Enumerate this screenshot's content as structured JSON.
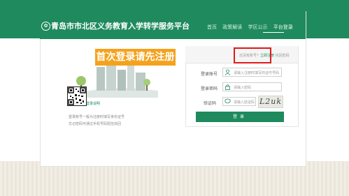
{
  "header": {
    "title": "青岛市市北区义务教育入学转学服务平台",
    "nav": [
      "首页",
      "政策解读",
      "学区公示",
      "平台登录"
    ],
    "active_nav": "平台登录",
    "logo_glyph": "✿"
  },
  "promo": {
    "banner": "首次登录请先注册"
  },
  "left": {
    "qr_label": "登录说明",
    "desc1": "登录账号一般为注册时填写身份证号",
    "desc2": "忘记密码可通过手机号码短信找回"
  },
  "login": {
    "tab_prefix": "还没有账号？",
    "tab_register": "立即注册",
    "tab_forgot": "找回密码",
    "account_label": "登录账号",
    "account_placeholder": "请输入注册时填写的证件号码",
    "password_label": "登录密码",
    "password_placeholder": "请输入密码",
    "captcha_label": "验证码",
    "captcha_placeholder": "请输入验证码",
    "captcha_text": "L2uk",
    "submit_label": "登录"
  },
  "colors": {
    "brand": "#1e8a5e",
    "accent": "#f4a21d",
    "highlight": "#e01b1b"
  }
}
